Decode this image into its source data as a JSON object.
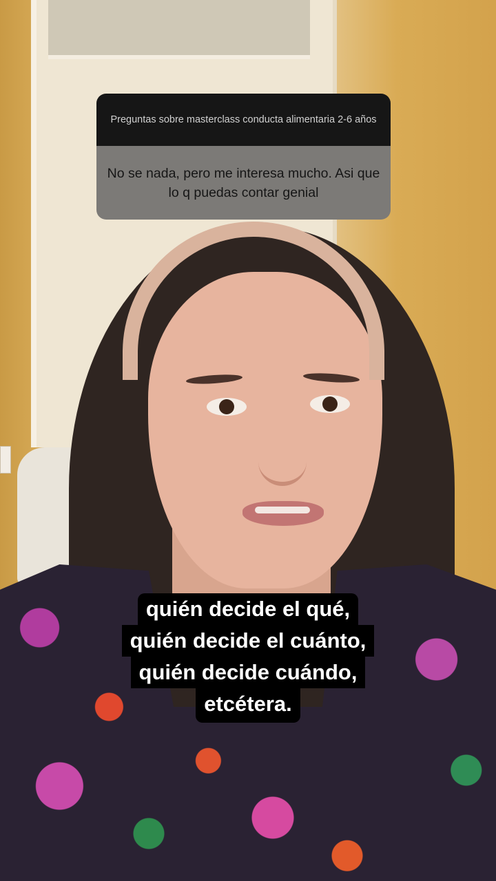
{
  "question_sticker": {
    "title": "Preguntas sobre masterclass conducta alimentaria 2-6 años",
    "answer": "No se nada, pero me interesa mucho. Asi que lo q puedas contar genial"
  },
  "captions": {
    "lines": [
      "quién decide el qué,",
      "quién decide el cuánto,",
      "quién decide cuándo,",
      "etcétera."
    ]
  }
}
